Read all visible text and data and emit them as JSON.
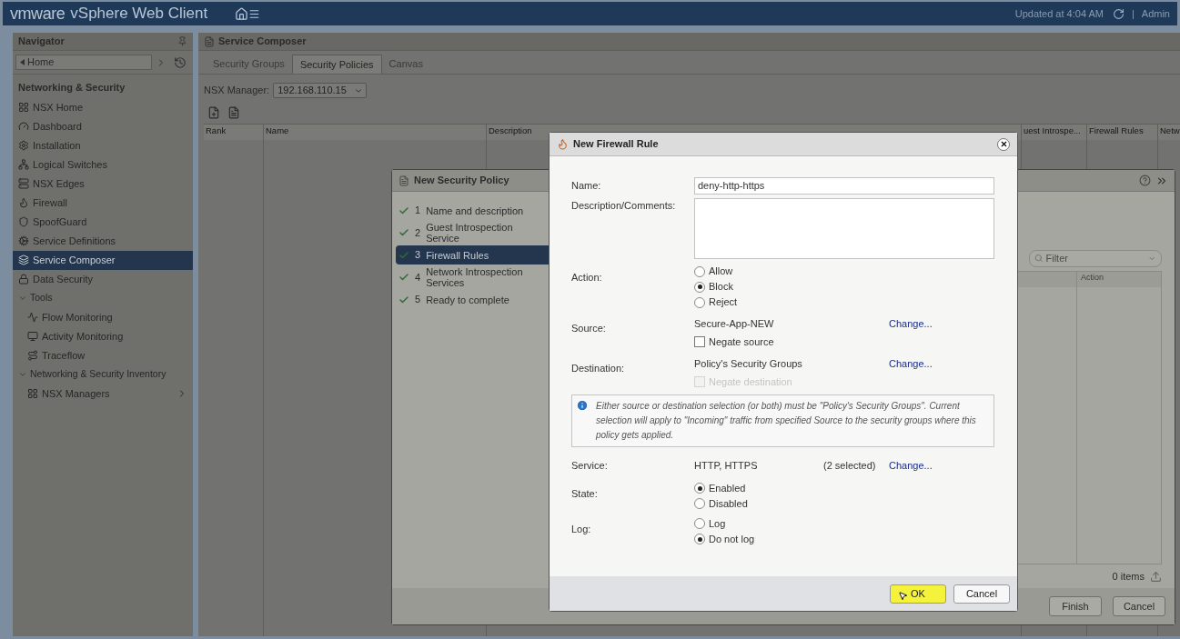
{
  "app_bar": {
    "brand": "vmware",
    "product": "vSphere Web Client",
    "status": "Updated at 4:04 AM",
    "separator": "|",
    "user": "Admin"
  },
  "navigator": {
    "title": "Navigator",
    "back_label": "Home",
    "section": "Networking & Security",
    "items": [
      {
        "label": "NSX Home",
        "selected": false
      },
      {
        "label": "Dashboard",
        "selected": false
      },
      {
        "label": "Installation",
        "selected": false
      },
      {
        "label": "Logical Switches",
        "selected": false
      },
      {
        "label": "NSX Edges",
        "selected": false
      },
      {
        "label": "Firewall",
        "selected": false
      },
      {
        "label": "SpoofGuard",
        "selected": false
      },
      {
        "label": "Service Definitions",
        "selected": false
      },
      {
        "label": "Service Composer",
        "selected": true
      },
      {
        "label": "Data Security",
        "selected": false
      }
    ],
    "groups": [
      {
        "label": "Tools",
        "expanded": true,
        "items": [
          {
            "label": "Flow Monitoring",
            "has_children": false
          },
          {
            "label": "Activity Monitoring",
            "has_children": false
          },
          {
            "label": "Traceflow",
            "has_children": false
          }
        ]
      },
      {
        "label": "Networking & Security Inventory",
        "expanded": true,
        "items": [
          {
            "label": "NSX Managers",
            "has_children": true
          }
        ]
      }
    ]
  },
  "service_composer": {
    "title": "Service Composer",
    "tabs": [
      {
        "label": "Security Groups",
        "selected": false
      },
      {
        "label": "Security Policies",
        "selected": true
      },
      {
        "label": "Canvas",
        "selected": false
      }
    ],
    "nsx_manager": {
      "label": "NSX Manager:",
      "value": "192.168.110.15"
    },
    "columns": [
      "Rank",
      "Name",
      "Description",
      "uest Introspe...",
      "Firewall Rules",
      "Netw"
    ]
  },
  "wizard": {
    "title": "New Security Policy",
    "steps": [
      {
        "number": "1",
        "label": "Name and description",
        "done": true,
        "selected": false
      },
      {
        "number": "2",
        "label": "Guest Introspection Service",
        "done": true,
        "selected": false
      },
      {
        "number": "3",
        "label": "Firewall Rules",
        "done": true,
        "selected": true
      },
      {
        "number": "4",
        "label": "Network Introspection Services",
        "done": true,
        "selected": false
      },
      {
        "number": "5",
        "label": "Ready to complete",
        "done": true,
        "selected": false
      }
    ],
    "filter": {
      "placeholder": "Filter"
    },
    "columns": [
      "Action"
    ],
    "count": "0 items",
    "buttons": [
      "Finish",
      "Cancel"
    ]
  },
  "dialog": {
    "title": "New Firewall Rule",
    "name": {
      "label": "Name:",
      "value": "deny-http-https"
    },
    "description": {
      "label": "Description/Comments:"
    },
    "action": {
      "label": "Action:",
      "options": [
        {
          "label": "Allow",
          "selected": false
        },
        {
          "label": "Block",
          "selected": true
        },
        {
          "label": "Reject",
          "selected": false
        }
      ]
    },
    "source": {
      "label": "Source:",
      "value": "Secure-App-NEW",
      "link": "Change...",
      "negate": {
        "label": "Negate source",
        "checked": false,
        "disabled": false
      }
    },
    "destination": {
      "label": "Destination:",
      "value": "Policy's Security Groups",
      "link": "Change...",
      "negate": {
        "label": "Negate destination",
        "checked": false,
        "disabled": true
      }
    },
    "info": "Either source or destination selection (or both) must be \"Policy's Security Groups\". Current selection will apply to \"Incoming\" traffic from specified Source to the security groups where this policy gets applied.",
    "service": {
      "label": "Service:",
      "value": "HTTP, HTTPS",
      "count": "(2 selected)",
      "link": "Change..."
    },
    "state": {
      "label": "State:",
      "options": [
        {
          "label": "Enabled",
          "selected": true
        },
        {
          "label": "Disabled",
          "selected": false
        }
      ]
    },
    "log": {
      "label": "Log:",
      "options": [
        {
          "label": "Log",
          "selected": false
        },
        {
          "label": "Do not log",
          "selected": true
        }
      ]
    },
    "buttons": [
      {
        "label": "OK",
        "highlighted": true
      },
      {
        "label": "Cancel",
        "highlighted": false
      }
    ]
  }
}
